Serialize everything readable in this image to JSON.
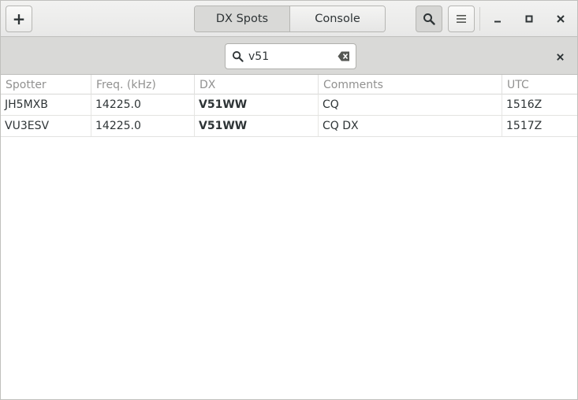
{
  "header": {
    "add_label": "+",
    "tabs": [
      {
        "label": "DX Spots",
        "active": true
      },
      {
        "label": "Console",
        "active": false
      }
    ]
  },
  "search": {
    "value": "v51"
  },
  "table": {
    "columns": [
      "Spotter",
      "Freq. (kHz)",
      "DX",
      "Comments",
      "UTC"
    ],
    "rows": [
      {
        "spotter": "JH5MXB",
        "freq": "14225.0",
        "dx": "V51WW",
        "comments": "CQ",
        "utc": "1516Z"
      },
      {
        "spotter": "VU3ESV",
        "freq": "14225.0",
        "dx": "V51WW",
        "comments": "CQ DX",
        "utc": "1517Z"
      }
    ]
  },
  "colors": {
    "headerbar": "#e8e8e7",
    "searchbar": "#d9d9d7",
    "column_header_text": "#919190",
    "text": "#2e3436"
  },
  "icons": [
    "add-icon",
    "search-icon",
    "menu-icon",
    "minimize-icon",
    "maximize-icon",
    "close-icon",
    "clear-icon"
  ]
}
